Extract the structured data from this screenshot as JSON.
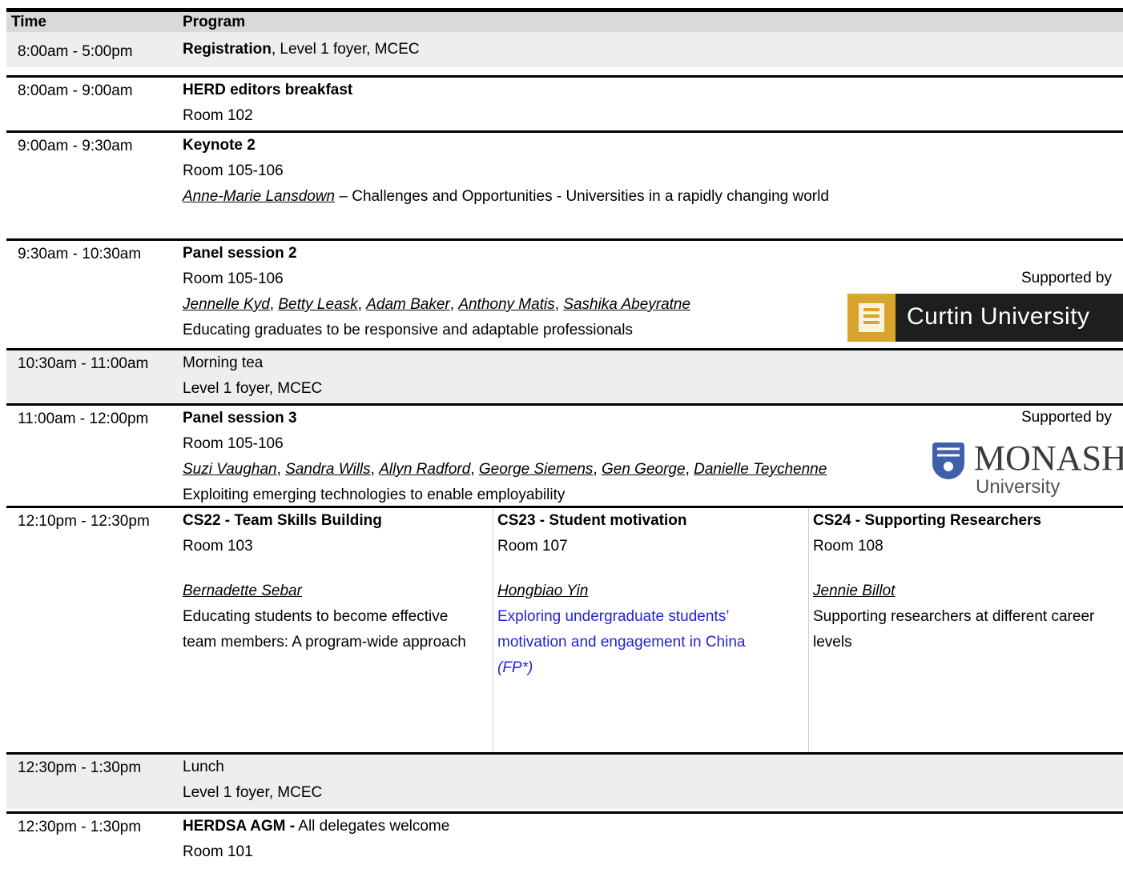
{
  "header": {
    "time": "Time",
    "program": "Program"
  },
  "rows": {
    "r1": {
      "time": "8:00am - 5:00pm",
      "bold": "Registration",
      "rest": ", Level 1 foyer, MCEC"
    },
    "r2": {
      "time": "8:00am - 9:00am",
      "title": "HERD editors breakfast",
      "room": "Room 102"
    },
    "r3": {
      "time": "9:00am - 9:30am",
      "title": "Keynote 2",
      "room": "Room 105-106",
      "speaker": "Anne-Marie Lansdown",
      "desc": " – Challenges and Opportunities - Universities in a rapidly changing world"
    },
    "r4": {
      "time": "9:30am - 10:30am",
      "title": "Panel session 2",
      "room": "Room 105-106",
      "speakers": [
        "Jennelle Kyd",
        "Betty Leask",
        "Adam Baker",
        "Anthony Matis",
        "Sashika Abeyratne"
      ],
      "sep": ", ",
      "desc": "Educating graduates to be responsive and adaptable professionals",
      "supported": "Supported by",
      "sponsor": "Curtin University"
    },
    "r5": {
      "time": "10:30am - 11:00am",
      "title": "Morning tea",
      "room": "Level 1 foyer, MCEC"
    },
    "r6": {
      "time": "11:00am - 12:00pm",
      "title": "Panel session 3",
      "room": "Room 105-106",
      "speakers": [
        "Suzi Vaughan",
        "Sandra Wills",
        "Allyn Radford",
        "George Siemens",
        "Gen George",
        "Danielle Teychenne"
      ],
      "desc": "Exploiting emerging technologies to enable employability",
      "supported": "Supported by",
      "sponsor_line1": "MONASH",
      "sponsor_line2": "University"
    },
    "r7": {
      "time": "12:10pm - 12:30pm",
      "cs22": {
        "title": "CS22 - Team Skills Building",
        "room": "Room 103",
        "speaker": "Bernadette Sebar",
        "desc": "Educating students to become effective team members: A program-wide approach"
      },
      "cs23": {
        "title": "CS23 - Student motivation",
        "room": "Room 107",
        "speaker": "Hongbiao Yin",
        "desc": "Exploring undergraduate students’ motivation and engagement in China",
        "tag": "(FP*)"
      },
      "cs24": {
        "title": "CS24 - Supporting Researchers",
        "room": "Room 108",
        "speaker": "Jennie Billot",
        "desc": "Supporting researchers at different career levels"
      }
    },
    "r8": {
      "time": "12:30pm - 1:30pm",
      "title": "Lunch",
      "room": "Level 1 foyer, MCEC"
    },
    "r9": {
      "time": "12:30pm - 1:30pm",
      "title": "HERDSA AGM -",
      "rest": " All delegates welcome",
      "room": "Room 101"
    }
  },
  "colors": {
    "link_blue": "#2323d6",
    "curtin_gold": "#d9a42c",
    "monash_blue": "#3f5fa8"
  }
}
